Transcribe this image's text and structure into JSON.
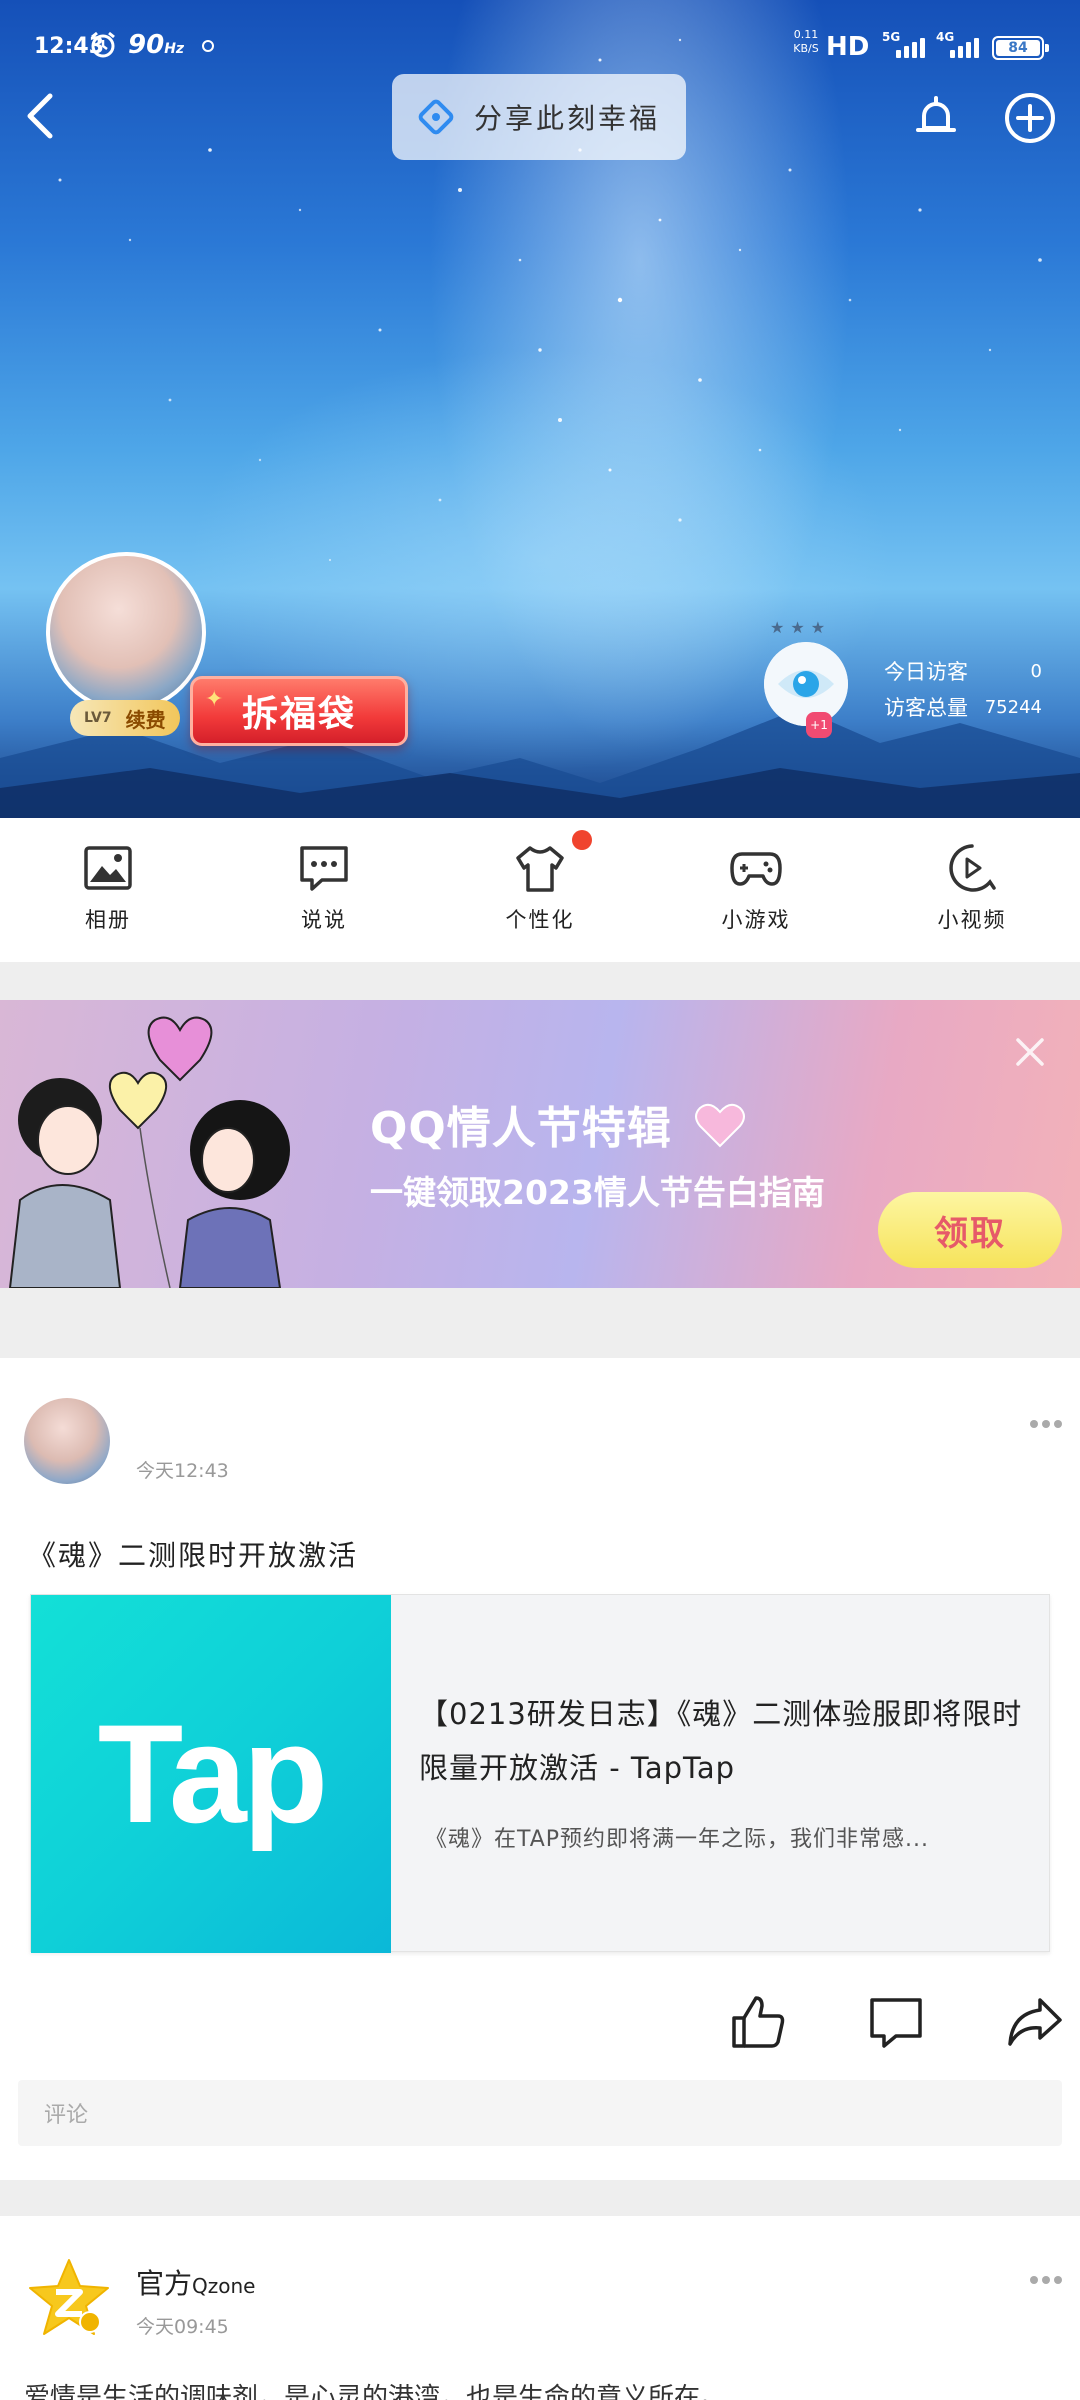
{
  "status_bar": {
    "time": "12:43",
    "refresh_rate": "90",
    "refresh_unit": "Hz",
    "net_speed": "0.11",
    "net_speed_unit": "KB/S",
    "hd": "HD",
    "net1": "5G",
    "net2": "4G",
    "battery": "84"
  },
  "header": {
    "share_label": "分享此刻幸福"
  },
  "profile": {
    "level": "LV7",
    "renew_label": "续费",
    "lucky_bag_label": "拆福袋",
    "visitor_today_label": "今日访客",
    "visitor_today_value": "0",
    "visitor_total_label": "访客总量",
    "visitor_total_value": "75244",
    "eye_badge": "+1"
  },
  "quick_menu": [
    {
      "label": "相册",
      "icon": "photo-album-icon"
    },
    {
      "label": "说说",
      "icon": "chat-bubble-icon"
    },
    {
      "label": "个性化",
      "icon": "tshirt-icon"
    },
    {
      "label": "小游戏",
      "icon": "gamepad-icon"
    },
    {
      "label": "小视频",
      "icon": "video-play-icon"
    }
  ],
  "banner": {
    "title": "QQ情人节特辑",
    "subtitle": "一键领取2023情人节告白指南",
    "button": "领取"
  },
  "post1": {
    "time": "今天12:43",
    "text": "《魂》二测限时开放激活",
    "card_thumb_text": "Tap",
    "card_title": "【0213研发日志】《魂》二测体验服即将限时限量开放激活 - TapTap",
    "card_desc": "《魂》在TAP预约即将满一年之际，我们非常感..."
  },
  "comment": {
    "placeholder": "评论"
  },
  "post2": {
    "author": "官方",
    "author_suffix": "Qzone",
    "time": "今天09:45",
    "text": "爱情是生活的调味剂，是心灵的港湾，也是生命的意义所在。"
  },
  "colors": {
    "accent_red": "#f0442e",
    "link_thumb": "#13e0d7",
    "banner_button": "#f6e35a"
  }
}
